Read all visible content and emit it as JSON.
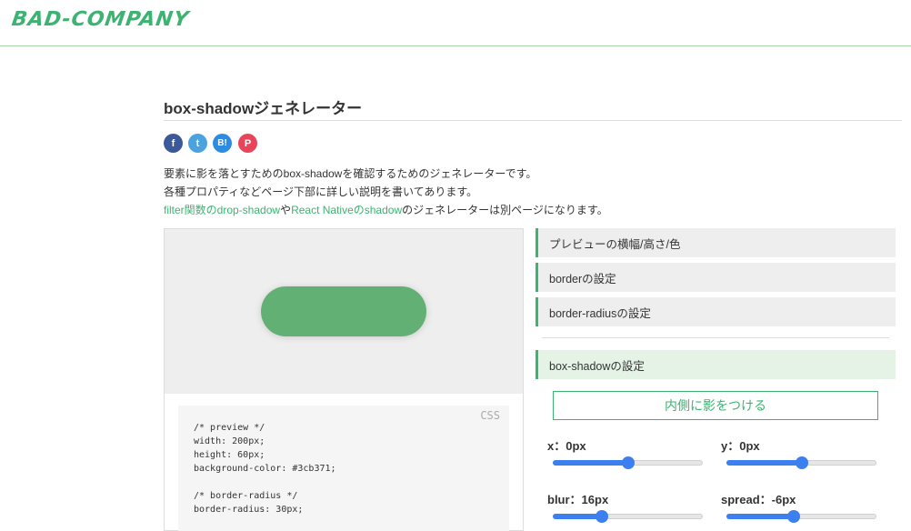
{
  "header": {
    "logo": "BAD-COMPANY"
  },
  "page": {
    "title": "box-shadowジェネレーター"
  },
  "share": {
    "facebook": "f",
    "twitter": "t",
    "hatena": "B!",
    "pocket": "P"
  },
  "intro": {
    "line1": "要素に影を落とすためのbox-shadowを確認するためのジェネレーターです。",
    "line2": "各種プロパティなどページ下部に詳しい説明を書いてあります。",
    "line3": {
      "link1": "filter関数のdrop-shadow",
      "text1": "や",
      "link2": "React Nativeのshadow",
      "text2": "のジェネレーターは別ページになります。"
    }
  },
  "code": {
    "lang": "CSS",
    "text": "/* preview */\nwidth: 200px;\nheight: 60px;\nbackground-color: #3cb371;\n\n/* border-radius */\nborder-radius: 30px;"
  },
  "panels": {
    "preview_size": "プレビューの横幅/高さ/色",
    "border": "borderの設定",
    "border_radius": "border-radiusの設定",
    "box_shadow": "box-shadowの設定"
  },
  "controls": {
    "inset_button": "内側に影をつける",
    "x": {
      "label": "x：0px",
      "fraction": 0.5
    },
    "y": {
      "label": "y：0px",
      "fraction": 0.5
    },
    "blur": {
      "label": "blur：16px",
      "fraction": 0.33
    },
    "spread": {
      "label": "spread：-6px",
      "fraction": 0.45
    }
  },
  "colors": {
    "accent": "#3cb371",
    "slider": "#3c7fee",
    "preview_box": "#62b074"
  }
}
